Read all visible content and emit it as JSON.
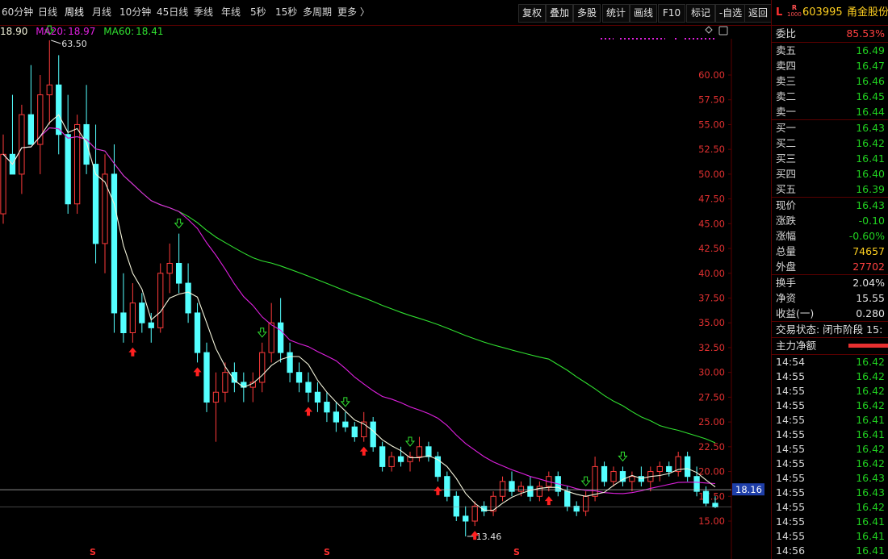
{
  "toolbar": {
    "periods": [
      {
        "label": "60分钟",
        "active": false
      },
      {
        "label": "日线",
        "active": false
      },
      {
        "label": "周线",
        "active": true
      },
      {
        "label": "月线",
        "active": false
      },
      {
        "label": "10分钟",
        "active": false
      },
      {
        "label": "45日线",
        "active": false
      },
      {
        "label": "季线",
        "active": false
      },
      {
        "label": "年线",
        "active": false
      },
      {
        "label": "5秒",
        "active": false
      },
      {
        "label": "15秒",
        "active": false
      },
      {
        "label": "多周期",
        "active": false
      },
      {
        "label": "更多 〉",
        "active": false
      }
    ],
    "buttons": [
      "复权",
      "叠加",
      "多股",
      "统计",
      "画线",
      "F10",
      "标记",
      "-自选",
      "返回"
    ]
  },
  "ma": {
    "ma5_value": "18.90",
    "ma20_label": "MA20:",
    "ma20_value": "18.97",
    "ma60_label": "MA60:",
    "ma60_value": "18.41"
  },
  "colors": {
    "up": "#ff3b3b",
    "down": "#54ffff",
    "ma5": "#f5f5dc",
    "ma20": "#e020e0",
    "ma60": "#30e030",
    "axis_text": "#e03030",
    "grid": "#5a0000"
  },
  "chart": {
    "high_label": "63.50",
    "low_label": "13.46",
    "current_price_tag": "18.16",
    "y_ticks": [
      "60.00",
      "57.50",
      "55.00",
      "52.50",
      "50.00",
      "47.50",
      "45.00",
      "42.50",
      "40.00",
      "37.50",
      "35.00",
      "32.50",
      "30.00",
      "27.50",
      "25.00",
      "22.50",
      "20.00",
      "17.50",
      "15.00"
    ],
    "bottom_markers": [
      "S",
      "S",
      "S"
    ]
  },
  "chart_data": {
    "type": "candlestick",
    "period": "weekly",
    "ylim": [
      13.0,
      64.5
    ],
    "y_ticks": [
      60,
      57.5,
      55,
      52.5,
      50,
      47.5,
      45,
      42.5,
      40,
      37.5,
      35,
      32.5,
      30,
      27.5,
      25,
      22.5,
      20,
      17.5,
      15
    ],
    "ohlc": [
      [
        46,
        54,
        45,
        52
      ],
      [
        52,
        58,
        50,
        50
      ],
      [
        50,
        57,
        48,
        56
      ],
      [
        56,
        61,
        53,
        53
      ],
      [
        53,
        60,
        50,
        58
      ],
      [
        58,
        63.5,
        55,
        59
      ],
      [
        59,
        62,
        52,
        54
      ],
      [
        54,
        58,
        46,
        47
      ],
      [
        47,
        56,
        46,
        55
      ],
      [
        55,
        59,
        50,
        51
      ],
      [
        51,
        55,
        41,
        43
      ],
      [
        43,
        52,
        40,
        50
      ],
      [
        50,
        53,
        34,
        36
      ],
      [
        36,
        40,
        33,
        34
      ],
      [
        34,
        39,
        33,
        37
      ],
      [
        37,
        38,
        34,
        35
      ],
      [
        35,
        36,
        33,
        34.5
      ],
      [
        34.5,
        41,
        34,
        40
      ],
      [
        40,
        43,
        38,
        41
      ],
      [
        41,
        44,
        38,
        39
      ],
      [
        39,
        41,
        35,
        36
      ],
      [
        36,
        37,
        31,
        32
      ],
      [
        32,
        33,
        26,
        27
      ],
      [
        27,
        30,
        23,
        28
      ],
      [
        28,
        31,
        27,
        30
      ],
      [
        30,
        31,
        28,
        29
      ],
      [
        29,
        30,
        27,
        28.5
      ],
      [
        28.5,
        30,
        27,
        29
      ],
      [
        29,
        33,
        28,
        32
      ],
      [
        32,
        37,
        31,
        35
      ],
      [
        35,
        37.5,
        31,
        32
      ],
      [
        32,
        33,
        29,
        30
      ],
      [
        30,
        31,
        28,
        29
      ],
      [
        29,
        30,
        27,
        28
      ],
      [
        28,
        29,
        26,
        27
      ],
      [
        27,
        28,
        25,
        26
      ],
      [
        26,
        27,
        24,
        25
      ],
      [
        25,
        26,
        24,
        24.5
      ],
      [
        24.5,
        25,
        23,
        23.5
      ],
      [
        23.5,
        26,
        23,
        25
      ],
      [
        25,
        25.5,
        22,
        22.5
      ],
      [
        22.5,
        23,
        20,
        20.5
      ],
      [
        20.5,
        22,
        20,
        21.5
      ],
      [
        21.5,
        22.5,
        20.5,
        21
      ],
      [
        21,
        22,
        20,
        21.5
      ],
      [
        21.5,
        23.5,
        21,
        22.5
      ],
      [
        22.5,
        23,
        21,
        21.5
      ],
      [
        21.5,
        22,
        19,
        19.5
      ],
      [
        19.5,
        20,
        17,
        17.5
      ],
      [
        17.5,
        18,
        15,
        15.5
      ],
      [
        15.5,
        16.5,
        13.46,
        15
      ],
      [
        15,
        17,
        14.5,
        16.5
      ],
      [
        16.5,
        17,
        15.5,
        16
      ],
      [
        16,
        18,
        15.5,
        17.5
      ],
      [
        17.5,
        19.5,
        17,
        19
      ],
      [
        19,
        20,
        17.5,
        18
      ],
      [
        18,
        19,
        17.5,
        18.5
      ],
      [
        18.5,
        19.5,
        17,
        17.5
      ],
      [
        17.5,
        19,
        17,
        18.5
      ],
      [
        18.5,
        20,
        18,
        19.5
      ],
      [
        19.5,
        20,
        17.5,
        18
      ],
      [
        18,
        18.5,
        16,
        16.5
      ],
      [
        16.5,
        17,
        15.5,
        16
      ],
      [
        16,
        18,
        15.5,
        17.5
      ],
      [
        17.5,
        21.5,
        17,
        20.5
      ],
      [
        20.5,
        21,
        18.5,
        19
      ],
      [
        19,
        20.5,
        18.5,
        20
      ],
      [
        20,
        20.5,
        18.5,
        19
      ],
      [
        19,
        20,
        18,
        19.5
      ],
      [
        19.5,
        20.5,
        18.5,
        19
      ],
      [
        19,
        20.5,
        18,
        20
      ],
      [
        20,
        21,
        19,
        20.5
      ],
      [
        20.5,
        21,
        19.5,
        20
      ],
      [
        20,
        22,
        19.5,
        21.5
      ],
      [
        21.5,
        22,
        19,
        19.5
      ],
      [
        19.5,
        20.5,
        17.5,
        18
      ],
      [
        18,
        18.5,
        16.5,
        16.8
      ],
      [
        16.8,
        17.5,
        16.3,
        16.43
      ]
    ],
    "ma5_latest": 18.9,
    "ma20_latest": 18.97,
    "ma60_latest": 18.41,
    "high": 63.5,
    "low": 13.46,
    "last_price_line": 18.16
  },
  "sidebar": {
    "letter_l": "L",
    "tag_r": "R",
    "tag_sub": "1000",
    "code": "603995",
    "name": "甬金股份",
    "weibi_label": "委比",
    "weibi_value": "85.53%",
    "sell": [
      {
        "label": "卖五",
        "price": "16.49"
      },
      {
        "label": "卖四",
        "price": "16.47"
      },
      {
        "label": "卖三",
        "price": "16.46"
      },
      {
        "label": "卖二",
        "price": "16.45"
      },
      {
        "label": "卖一",
        "price": "16.44"
      }
    ],
    "buy": [
      {
        "label": "买一",
        "price": "16.43"
      },
      {
        "label": "买二",
        "price": "16.42"
      },
      {
        "label": "买三",
        "price": "16.41"
      },
      {
        "label": "买四",
        "price": "16.40"
      },
      {
        "label": "买五",
        "price": "16.39"
      }
    ],
    "quote": [
      {
        "label": "现价",
        "value": "16.43"
      },
      {
        "label": "涨跌",
        "value": "-0.10"
      },
      {
        "label": "涨幅",
        "value": "-0.60%"
      },
      {
        "label": "总量",
        "value": "74657"
      },
      {
        "label": "外盘",
        "value": "27702"
      }
    ],
    "stats": [
      {
        "label": "换手",
        "value": "2.04%"
      },
      {
        "label": "净资",
        "value": "15.55"
      },
      {
        "label": "收益(一)",
        "value": "0.280"
      }
    ],
    "trade_status": "交易状态: 闭市阶段 15:",
    "main_net_label": "主力净额",
    "ticks": [
      {
        "time": "14:54",
        "price": "16.42"
      },
      {
        "time": "14:55",
        "price": "16.42"
      },
      {
        "time": "14:55",
        "price": "16.42"
      },
      {
        "time": "14:55",
        "price": "16.42"
      },
      {
        "time": "14:55",
        "price": "16.41"
      },
      {
        "time": "14:55",
        "price": "16.41"
      },
      {
        "time": "14:55",
        "price": "16.42"
      },
      {
        "time": "14:55",
        "price": "16.42"
      },
      {
        "time": "14:55",
        "price": "16.43"
      },
      {
        "time": "14:55",
        "price": "16.43"
      },
      {
        "time": "14:55",
        "price": "16.42"
      },
      {
        "time": "14:55",
        "price": "16.41"
      },
      {
        "time": "14:55",
        "price": "16.41"
      },
      {
        "time": "14:56",
        "price": "16.41"
      }
    ]
  }
}
